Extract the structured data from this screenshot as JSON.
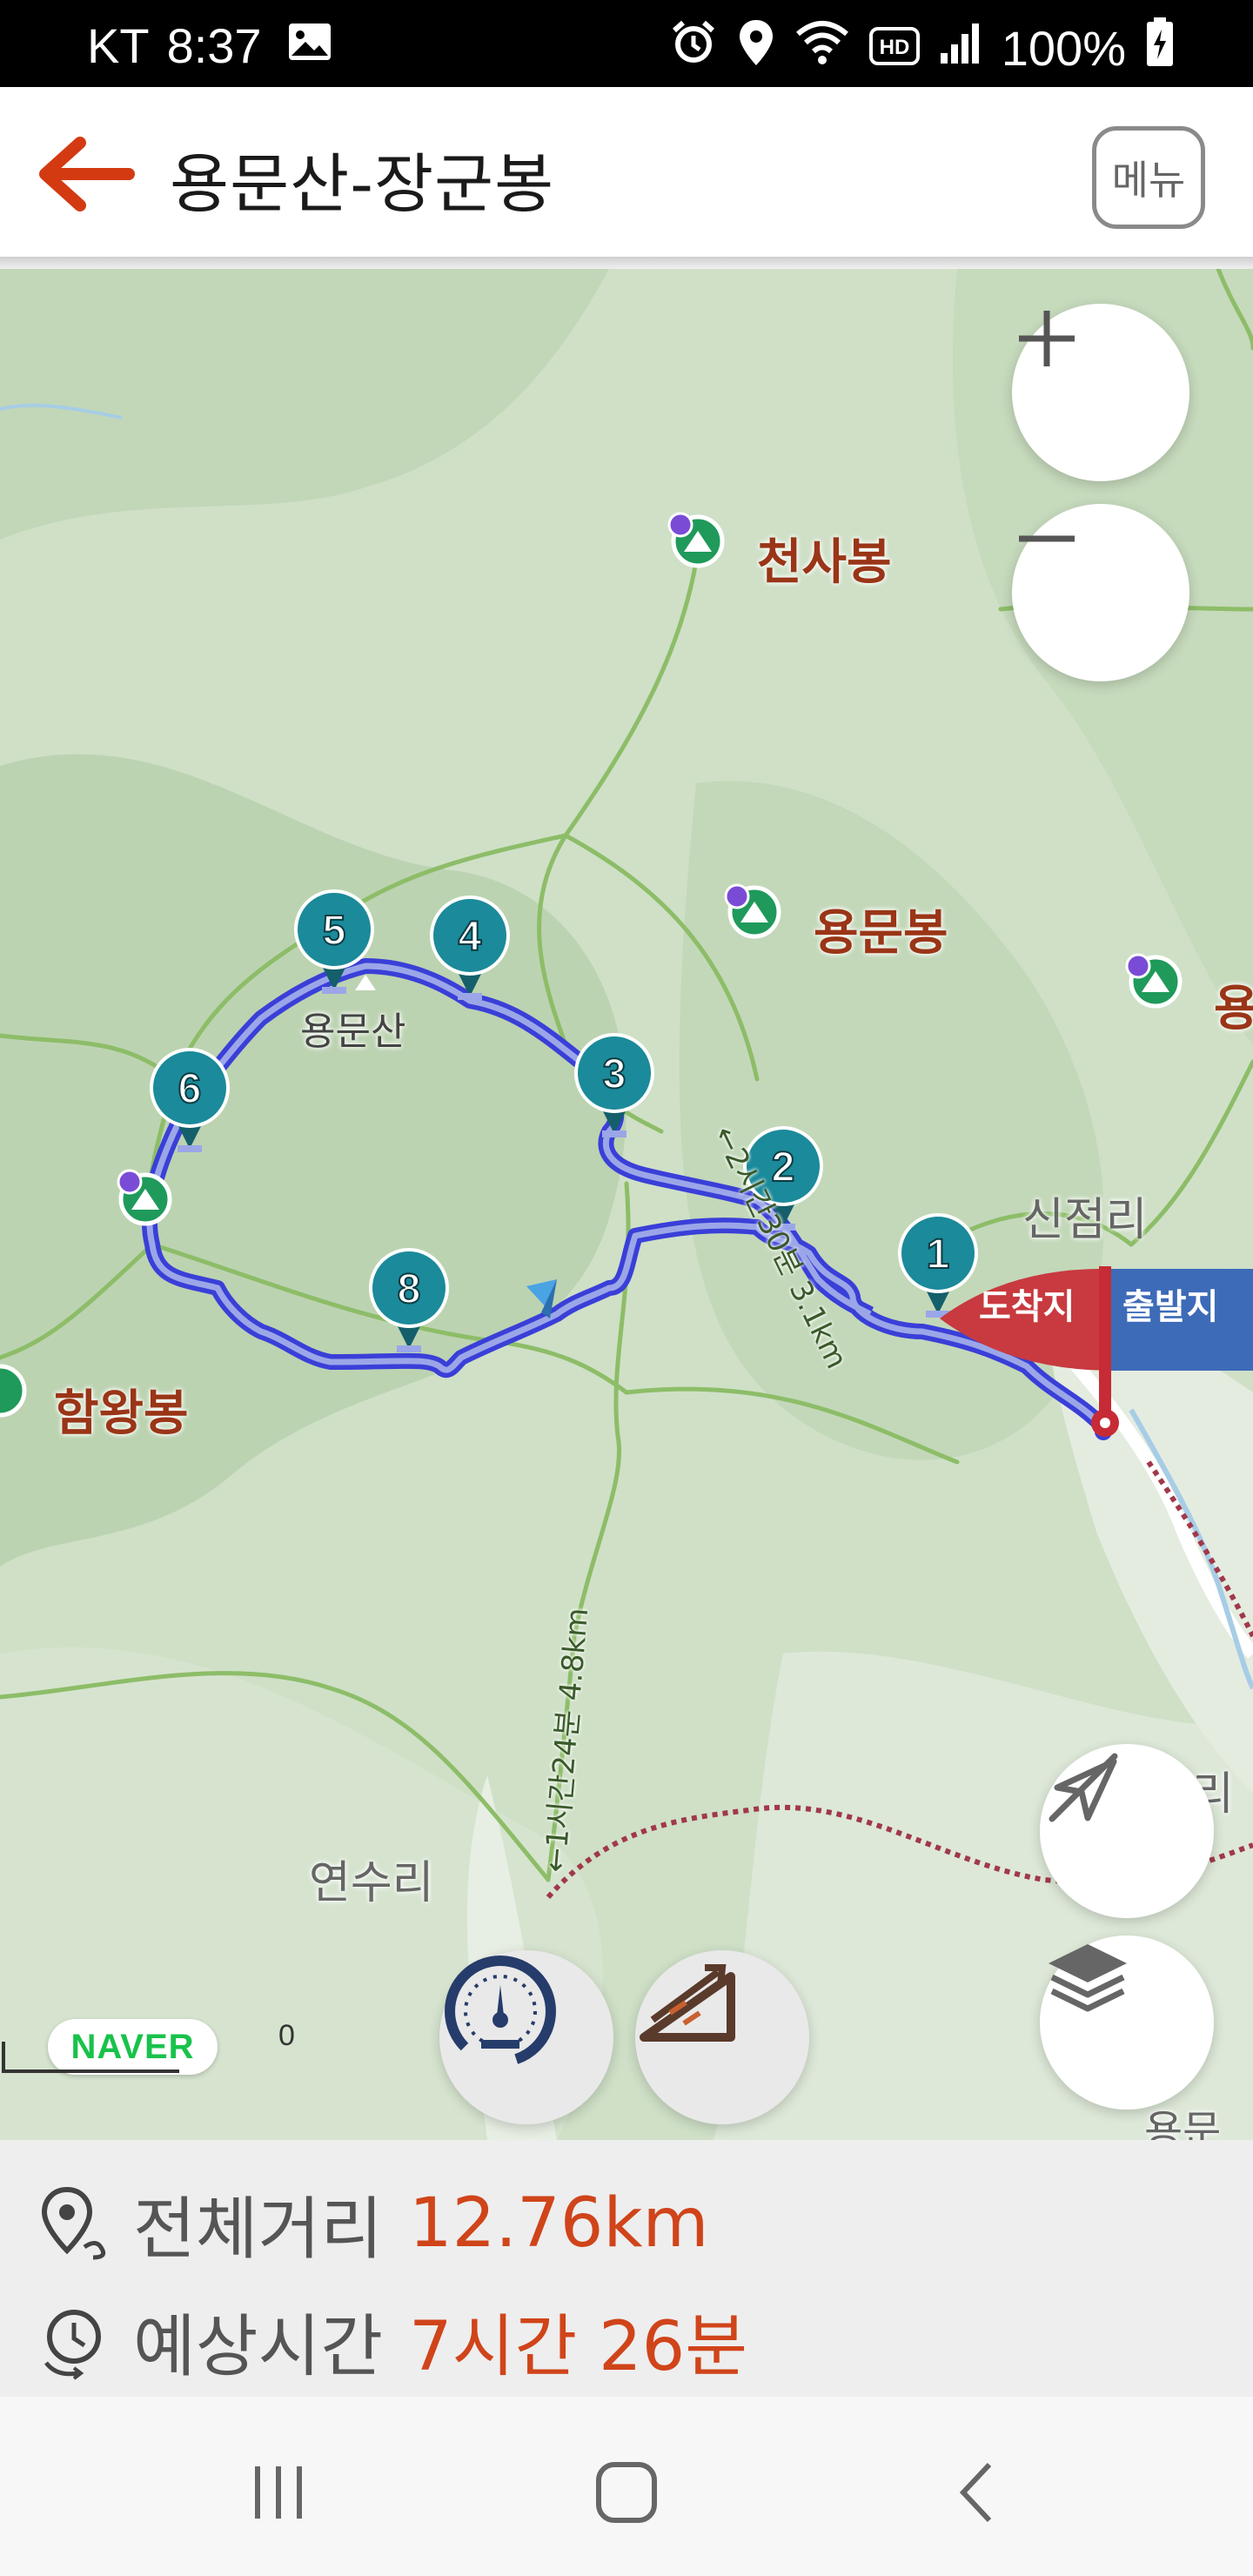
{
  "status_bar": {
    "carrier": "KT",
    "time": "8:37",
    "battery": "100%",
    "icons": [
      "gallery-icon",
      "alarm-icon",
      "location-icon",
      "wifi-icon",
      "hd-icon",
      "signal-icon",
      "battery-icon"
    ]
  },
  "header": {
    "title": "용문산-장군봉",
    "menu_label": "메뉴",
    "accent_color": "#d33a12"
  },
  "map": {
    "peaks": [
      {
        "name": "천사봉"
      },
      {
        "name": "용문봉"
      },
      {
        "name": "함왕봉"
      },
      {
        "name": "용"
      }
    ],
    "places": [
      {
        "name": "신점리"
      },
      {
        "name": "연수리"
      },
      {
        "name": "용문산"
      },
      {
        "name": "리"
      },
      {
        "name": "용문"
      }
    ],
    "trail_labels": {
      "trail_a": "←2시간30분 3.1km",
      "trail_b": "←1시간24분 4.8km"
    },
    "waypoints": [
      "1",
      "2",
      "3",
      "4",
      "5",
      "6",
      "8"
    ],
    "flags": {
      "arrival": "도착지",
      "departure": "출발지"
    },
    "naver_badge": "NAVER",
    "scale_label": "0",
    "route_color": "#2b2fd6",
    "waypoint_color": "#1b8a9a"
  },
  "info": {
    "distance_label": "전체거리",
    "distance_value": "12.76km",
    "time_label": "예상시간",
    "time_value": "7시간 26분",
    "value_color": "#d0441a"
  }
}
